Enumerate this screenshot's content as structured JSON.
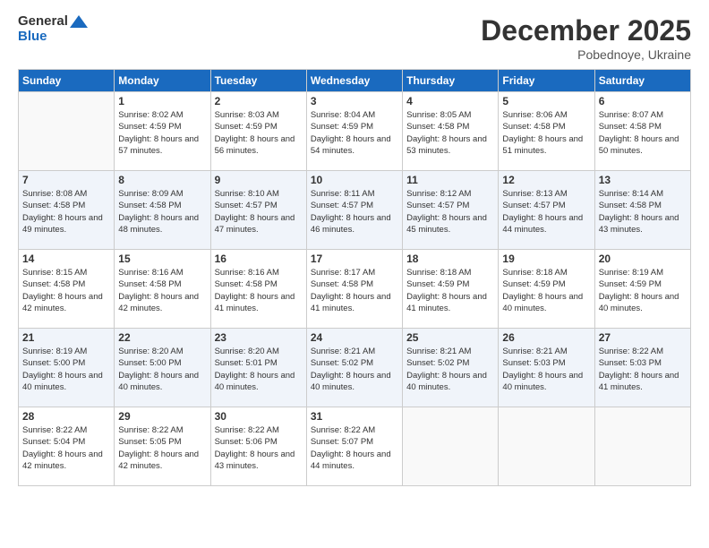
{
  "header": {
    "logo_general": "General",
    "logo_blue": "Blue",
    "month_title": "December 2025",
    "subtitle": "Pobednoye, Ukraine"
  },
  "days_of_week": [
    "Sunday",
    "Monday",
    "Tuesday",
    "Wednesday",
    "Thursday",
    "Friday",
    "Saturday"
  ],
  "weeks": [
    {
      "days": [
        {
          "number": "",
          "empty": true
        },
        {
          "number": "1",
          "sunrise": "Sunrise: 8:02 AM",
          "sunset": "Sunset: 4:59 PM",
          "daylight": "Daylight: 8 hours and 57 minutes."
        },
        {
          "number": "2",
          "sunrise": "Sunrise: 8:03 AM",
          "sunset": "Sunset: 4:59 PM",
          "daylight": "Daylight: 8 hours and 56 minutes."
        },
        {
          "number": "3",
          "sunrise": "Sunrise: 8:04 AM",
          "sunset": "Sunset: 4:59 PM",
          "daylight": "Daylight: 8 hours and 54 minutes."
        },
        {
          "number": "4",
          "sunrise": "Sunrise: 8:05 AM",
          "sunset": "Sunset: 4:58 PM",
          "daylight": "Daylight: 8 hours and 53 minutes."
        },
        {
          "number": "5",
          "sunrise": "Sunrise: 8:06 AM",
          "sunset": "Sunset: 4:58 PM",
          "daylight": "Daylight: 8 hours and 51 minutes."
        },
        {
          "number": "6",
          "sunrise": "Sunrise: 8:07 AM",
          "sunset": "Sunset: 4:58 PM",
          "daylight": "Daylight: 8 hours and 50 minutes."
        }
      ]
    },
    {
      "days": [
        {
          "number": "7",
          "sunrise": "Sunrise: 8:08 AM",
          "sunset": "Sunset: 4:58 PM",
          "daylight": "Daylight: 8 hours and 49 minutes."
        },
        {
          "number": "8",
          "sunrise": "Sunrise: 8:09 AM",
          "sunset": "Sunset: 4:58 PM",
          "daylight": "Daylight: 8 hours and 48 minutes."
        },
        {
          "number": "9",
          "sunrise": "Sunrise: 8:10 AM",
          "sunset": "Sunset: 4:57 PM",
          "daylight": "Daylight: 8 hours and 47 minutes."
        },
        {
          "number": "10",
          "sunrise": "Sunrise: 8:11 AM",
          "sunset": "Sunset: 4:57 PM",
          "daylight": "Daylight: 8 hours and 46 minutes."
        },
        {
          "number": "11",
          "sunrise": "Sunrise: 8:12 AM",
          "sunset": "Sunset: 4:57 PM",
          "daylight": "Daylight: 8 hours and 45 minutes."
        },
        {
          "number": "12",
          "sunrise": "Sunrise: 8:13 AM",
          "sunset": "Sunset: 4:57 PM",
          "daylight": "Daylight: 8 hours and 44 minutes."
        },
        {
          "number": "13",
          "sunrise": "Sunrise: 8:14 AM",
          "sunset": "Sunset: 4:58 PM",
          "daylight": "Daylight: 8 hours and 43 minutes."
        }
      ]
    },
    {
      "days": [
        {
          "number": "14",
          "sunrise": "Sunrise: 8:15 AM",
          "sunset": "Sunset: 4:58 PM",
          "daylight": "Daylight: 8 hours and 42 minutes."
        },
        {
          "number": "15",
          "sunrise": "Sunrise: 8:16 AM",
          "sunset": "Sunset: 4:58 PM",
          "daylight": "Daylight: 8 hours and 42 minutes."
        },
        {
          "number": "16",
          "sunrise": "Sunrise: 8:16 AM",
          "sunset": "Sunset: 4:58 PM",
          "daylight": "Daylight: 8 hours and 41 minutes."
        },
        {
          "number": "17",
          "sunrise": "Sunrise: 8:17 AM",
          "sunset": "Sunset: 4:58 PM",
          "daylight": "Daylight: 8 hours and 41 minutes."
        },
        {
          "number": "18",
          "sunrise": "Sunrise: 8:18 AM",
          "sunset": "Sunset: 4:59 PM",
          "daylight": "Daylight: 8 hours and 41 minutes."
        },
        {
          "number": "19",
          "sunrise": "Sunrise: 8:18 AM",
          "sunset": "Sunset: 4:59 PM",
          "daylight": "Daylight: 8 hours and 40 minutes."
        },
        {
          "number": "20",
          "sunrise": "Sunrise: 8:19 AM",
          "sunset": "Sunset: 4:59 PM",
          "daylight": "Daylight: 8 hours and 40 minutes."
        }
      ]
    },
    {
      "days": [
        {
          "number": "21",
          "sunrise": "Sunrise: 8:19 AM",
          "sunset": "Sunset: 5:00 PM",
          "daylight": "Daylight: 8 hours and 40 minutes."
        },
        {
          "number": "22",
          "sunrise": "Sunrise: 8:20 AM",
          "sunset": "Sunset: 5:00 PM",
          "daylight": "Daylight: 8 hours and 40 minutes."
        },
        {
          "number": "23",
          "sunrise": "Sunrise: 8:20 AM",
          "sunset": "Sunset: 5:01 PM",
          "daylight": "Daylight: 8 hours and 40 minutes."
        },
        {
          "number": "24",
          "sunrise": "Sunrise: 8:21 AM",
          "sunset": "Sunset: 5:02 PM",
          "daylight": "Daylight: 8 hours and 40 minutes."
        },
        {
          "number": "25",
          "sunrise": "Sunrise: 8:21 AM",
          "sunset": "Sunset: 5:02 PM",
          "daylight": "Daylight: 8 hours and 40 minutes."
        },
        {
          "number": "26",
          "sunrise": "Sunrise: 8:21 AM",
          "sunset": "Sunset: 5:03 PM",
          "daylight": "Daylight: 8 hours and 40 minutes."
        },
        {
          "number": "27",
          "sunrise": "Sunrise: 8:22 AM",
          "sunset": "Sunset: 5:03 PM",
          "daylight": "Daylight: 8 hours and 41 minutes."
        }
      ]
    },
    {
      "days": [
        {
          "number": "28",
          "sunrise": "Sunrise: 8:22 AM",
          "sunset": "Sunset: 5:04 PM",
          "daylight": "Daylight: 8 hours and 42 minutes."
        },
        {
          "number": "29",
          "sunrise": "Sunrise: 8:22 AM",
          "sunset": "Sunset: 5:05 PM",
          "daylight": "Daylight: 8 hours and 42 minutes."
        },
        {
          "number": "30",
          "sunrise": "Sunrise: 8:22 AM",
          "sunset": "Sunset: 5:06 PM",
          "daylight": "Daylight: 8 hours and 43 minutes."
        },
        {
          "number": "31",
          "sunrise": "Sunrise: 8:22 AM",
          "sunset": "Sunset: 5:07 PM",
          "daylight": "Daylight: 8 hours and 44 minutes."
        },
        {
          "number": "",
          "empty": true
        },
        {
          "number": "",
          "empty": true
        },
        {
          "number": "",
          "empty": true
        }
      ]
    }
  ]
}
